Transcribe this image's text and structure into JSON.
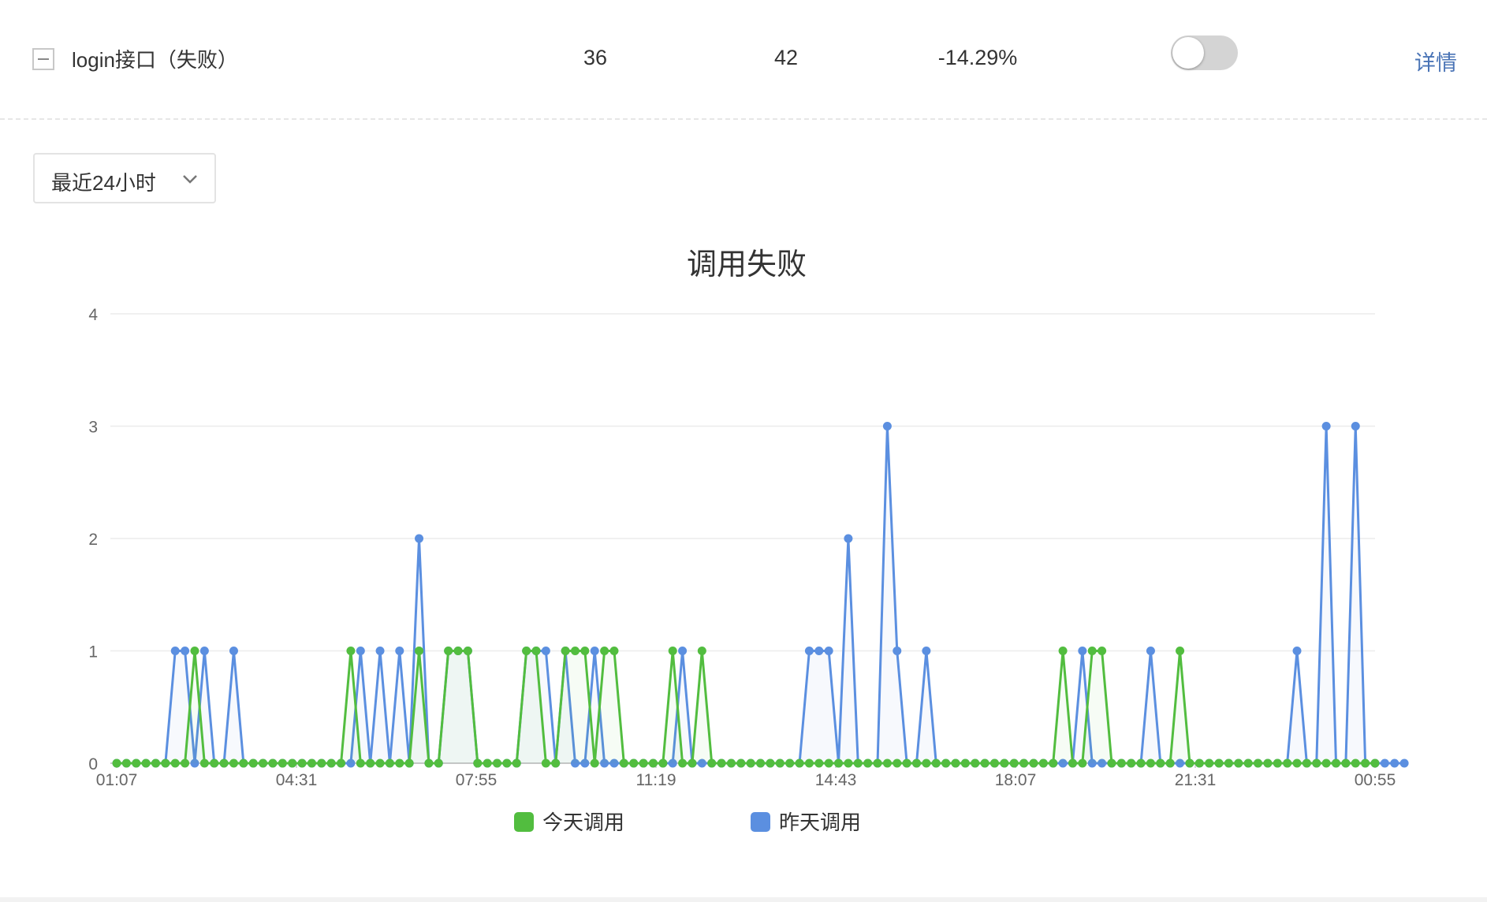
{
  "row": {
    "name": "login接口（失败）",
    "today_count": "36",
    "yesterday_count": "42",
    "change": "-14.29%",
    "toggle_on": false,
    "detail_label": "详情"
  },
  "range_select": {
    "value": "最近24小时"
  },
  "colors": {
    "today": "#52bd3f",
    "yesterday": "#5b8fe0",
    "link": "#4a74b6"
  },
  "chart_data": {
    "type": "line",
    "title": "调用失败",
    "ylim": [
      0,
      4
    ],
    "y_ticks": [
      "0",
      "1",
      "2",
      "3",
      "4"
    ],
    "x_tick_labels": [
      "01:07",
      "04:31",
      "07:55",
      "11:19",
      "14:43",
      "18:07",
      "21:31",
      "00:55"
    ],
    "grid": true,
    "legend_position": "bottom",
    "series": [
      {
        "name": "今天调用",
        "values": [
          0,
          0,
          0,
          0,
          0,
          0,
          0,
          0,
          1,
          0,
          0,
          0,
          0,
          0,
          0,
          0,
          0,
          0,
          0,
          0,
          0,
          0,
          0,
          0,
          1,
          0,
          0,
          0,
          0,
          0,
          0,
          1,
          0,
          0,
          1,
          1,
          1,
          0,
          0,
          0,
          0,
          0,
          1,
          1,
          0,
          0,
          1,
          1,
          1,
          0,
          1,
          1,
          0,
          0,
          0,
          0,
          0,
          1,
          0,
          0,
          1,
          0,
          0,
          0,
          0,
          0,
          0,
          0,
          0,
          0,
          0,
          0,
          0,
          0,
          0,
          0,
          0,
          0,
          0,
          0,
          0,
          0,
          0,
          0,
          0,
          0,
          0,
          0,
          0,
          0,
          0,
          0,
          0,
          0,
          0,
          0,
          0,
          1,
          0,
          0,
          1,
          1,
          0,
          0,
          0,
          0,
          0,
          0,
          0,
          1,
          0,
          0,
          0,
          0,
          0,
          0,
          0,
          0,
          0,
          0,
          0,
          0,
          0,
          0,
          0,
          0,
          0,
          0,
          0,
          0
        ]
      },
      {
        "name": "昨天调用",
        "values": [
          0,
          0,
          0,
          0,
          0,
          0,
          1,
          1,
          0,
          1,
          0,
          0,
          1,
          0,
          0,
          0,
          0,
          0,
          0,
          0,
          0,
          0,
          0,
          0,
          0,
          1,
          0,
          1,
          0,
          1,
          0,
          2,
          0,
          0,
          1,
          1,
          1,
          0,
          0,
          0,
          0,
          0,
          1,
          1,
          1,
          0,
          1,
          0,
          0,
          1,
          0,
          0,
          0,
          0,
          0,
          0,
          0,
          0,
          1,
          0,
          0,
          0,
          0,
          0,
          0,
          0,
          0,
          0,
          0,
          0,
          0,
          1,
          1,
          1,
          0,
          2,
          0,
          0,
          0,
          3,
          1,
          0,
          0,
          1,
          0,
          0,
          0,
          0,
          0,
          0,
          0,
          0,
          0,
          0,
          0,
          0,
          0,
          0,
          0,
          1,
          0,
          0,
          0,
          0,
          0,
          0,
          1,
          0,
          0,
          0,
          0,
          0,
          0,
          0,
          0,
          0,
          0,
          0,
          0,
          0,
          0,
          1,
          0,
          0,
          3,
          0,
          0,
          3,
          0,
          0,
          0,
          0,
          0
        ]
      }
    ]
  }
}
